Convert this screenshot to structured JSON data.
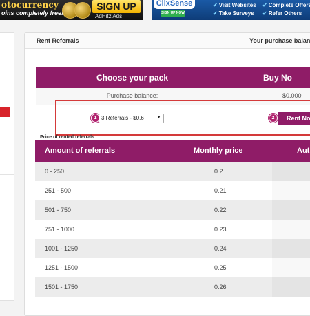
{
  "ads": {
    "banner1": {
      "title": "otocurrency",
      "subtitle": "oins completely free!",
      "signup": "SIGN UP",
      "network": "AdHitz Ads"
    },
    "banner2": {
      "brand": "ClixSense",
      "signup_now": "SIGN UP NOW",
      "items": [
        "Visit Websites",
        "Complete Offers",
        "Take Surveys",
        "Refer Others"
      ]
    }
  },
  "main": {
    "title": "Rent Referrals",
    "balance_label": "Your purchase balance"
  },
  "pack": {
    "choose_label": "Choose your pack",
    "buy_label": "Buy No",
    "purchase_balance_label": "Purchase balance:",
    "purchase_balance_value": "$0.000",
    "selected_pack": "3 Referrals - $0.6",
    "rent_button": "Rent No",
    "step1": "1",
    "step2": "2"
  },
  "price_table": {
    "caption": "Price of rented referrals",
    "headers": [
      "Amount of referrals",
      "Monthly price",
      "Aut"
    ],
    "rows": [
      {
        "amount": "0 - 250",
        "price": "0.2"
      },
      {
        "amount": "251 - 500",
        "price": "0.21"
      },
      {
        "amount": "501 - 750",
        "price": "0.22"
      },
      {
        "amount": "751 - 1000",
        "price": "0.23"
      },
      {
        "amount": "1001 - 1250",
        "price": "0.24"
      },
      {
        "amount": "1251 - 1500",
        "price": "0.25"
      },
      {
        "amount": "1501 - 1750",
        "price": "0.26"
      }
    ]
  },
  "colors": {
    "accent": "#8f1c67",
    "highlight_frame": "#d43a3a"
  }
}
